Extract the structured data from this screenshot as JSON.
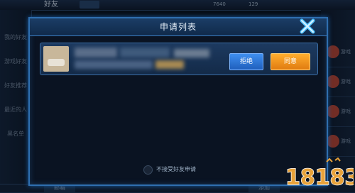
{
  "background": {
    "title": "好友",
    "currency_values": [
      "7640",
      "129"
    ],
    "sidebar_items": [
      "我的好友",
      "游戏好友",
      "好友推荐",
      "最近的人",
      "黑名单"
    ],
    "right_labels": [
      "游戏",
      "游戏",
      "游戏",
      "游戏"
    ],
    "bottom_left_label": "邮箱",
    "bottom_right_label": "添加"
  },
  "dialog": {
    "title": "申请列表",
    "close_icon": "close-x-icon",
    "request": {
      "reject_label": "拒绝",
      "accept_label": "同意"
    },
    "toggle_label": "不接受好友申请"
  },
  "watermark": {
    "text": "18183",
    "colors": {
      "main": "#e8a23a",
      "outline": "#ffffff"
    }
  },
  "colors": {
    "frame": "#2f6fb0",
    "reject_button": "#2f7ad8",
    "accept_button": "#f39a1e"
  }
}
